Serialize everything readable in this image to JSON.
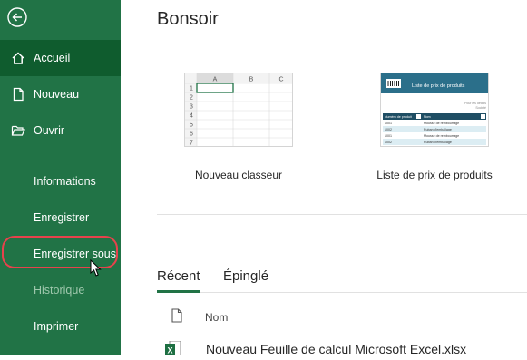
{
  "sidebar": {
    "items": [
      {
        "label": "Accueil"
      },
      {
        "label": "Nouveau"
      },
      {
        "label": "Ouvrir"
      },
      {
        "label": "Informations"
      },
      {
        "label": "Enregistrer"
      },
      {
        "label": "Enregistrer sous"
      },
      {
        "label": "Historique"
      },
      {
        "label": "Imprimer"
      }
    ],
    "colors": {
      "background": "#217346",
      "active": "#0f5c2e",
      "highlight": "#e8424c"
    }
  },
  "main": {
    "greeting": "Bonsoir",
    "templates": [
      {
        "label": "Nouveau classeur",
        "columns": [
          "A",
          "B",
          "C"
        ],
        "rows": [
          "1",
          "2",
          "3",
          "4",
          "5",
          "6",
          "7"
        ]
      },
      {
        "label": "Liste de prix de produits",
        "banner": "Liste de prix de produits",
        "note1": "Pour les détails",
        "note2": "Société",
        "col1": "Numéro de produit",
        "col2": "Nom",
        "rows": [
          {
            "num": "1001",
            "name": "Mousse de rembourrage"
          },
          {
            "num": "1002",
            "name": "Ruban d'emballage"
          },
          {
            "num": "1001",
            "name": "Mousse de rembourrage"
          },
          {
            "num": "1002",
            "name": "Ruban d'emballage"
          }
        ]
      }
    ],
    "tabs": [
      {
        "label": "Récent"
      },
      {
        "label": "Épinglé"
      }
    ],
    "file_list": {
      "header_name": "Nom",
      "files": [
        {
          "name": "Nouveau Feuille de calcul Microsoft Excel.xlsx",
          "icon": "excel-file-icon"
        }
      ]
    }
  }
}
